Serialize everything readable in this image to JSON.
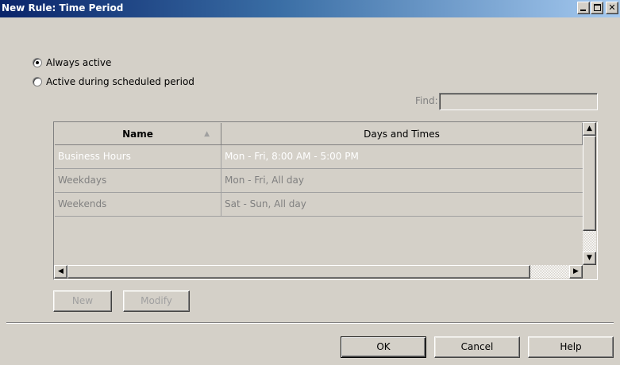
{
  "window": {
    "title": "New Rule: Time Period",
    "controls": [
      "minimize-icon",
      "maximize-icon",
      "close-icon"
    ]
  },
  "options": {
    "always_active": "Always active",
    "scheduled": "Active during scheduled period",
    "selected": "always_active"
  },
  "find": {
    "label": "Find:",
    "value": ""
  },
  "table": {
    "columns": [
      "Name",
      "Days and Times"
    ],
    "sort": {
      "column": "Name",
      "direction": "ascending"
    },
    "rows": [
      {
        "name": "Business Hours",
        "days": "Mon - Fri, 8:00 AM - 5:00 PM",
        "selected": true
      },
      {
        "name": "Weekdays",
        "days": "Mon - Fri, All day",
        "selected": false
      },
      {
        "name": "Weekends",
        "days": "Sat - Sun, All day",
        "selected": false
      }
    ]
  },
  "actions": {
    "new": "New",
    "modify": "Modify"
  },
  "footer": {
    "ok": "OK",
    "cancel": "Cancel",
    "help": "Help"
  }
}
